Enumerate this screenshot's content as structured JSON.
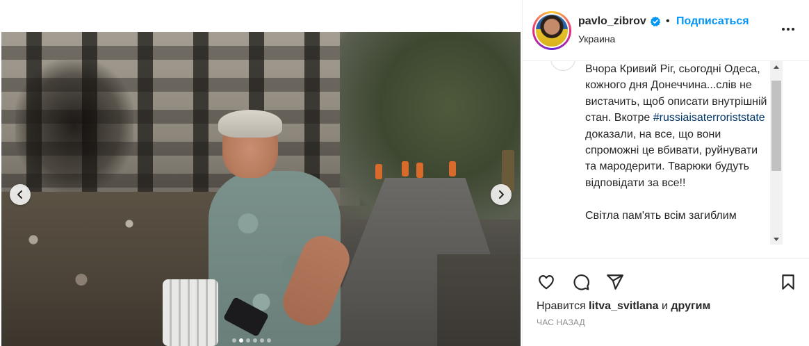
{
  "post": {
    "username": "pavlo_zibrov",
    "verified_icon": "verified-badge-icon",
    "separator": "•",
    "follow_label": "Подписаться",
    "location": "Украина"
  },
  "caption": {
    "text_before": "Вчора Кривий Ріг, сьогодні Одеса, кожного дня Донеччина...слів не вистачить, щоб описати внутрішній стан. Вкотре ",
    "hashtag": "#russiaisaterroriststate",
    "text_after": " доказали, на все, що вони спроможні це вбивати, руйнувати та мародерити. Тварюки будуть відповідати за все!!\n\nСвітла пам'ять всім загиблим"
  },
  "media": {
    "carousel_dots": 6,
    "active_dot": 1,
    "prev_icon": "chevron-left-icon",
    "next_icon": "chevron-right-icon"
  },
  "actions": {
    "like_icon": "heart-icon",
    "comment_icon": "comment-icon",
    "share_icon": "send-icon",
    "save_icon": "bookmark-icon"
  },
  "likes": {
    "prefix": "Нравится ",
    "user": "litva_svitlana",
    "and_word": " и ",
    "others": "другим"
  },
  "timestamp": "ЧАС НАЗАД",
  "colors": {
    "accent": "#0095f6",
    "hashtag": "#00376b",
    "text": "#262626",
    "muted": "#8e8e8e"
  }
}
